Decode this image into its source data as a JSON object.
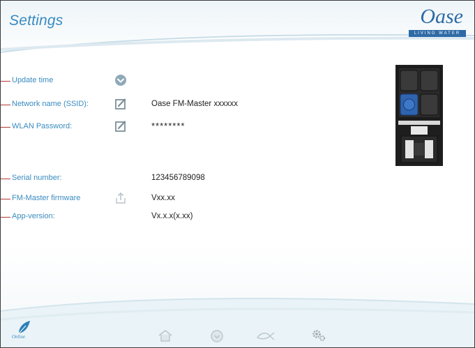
{
  "header": {
    "title": "Settings",
    "logo": {
      "brand": "Oase",
      "tagline": "LIVING WATER"
    }
  },
  "settings": [
    {
      "label": "Update time",
      "icon": "chevron-down-icon",
      "value": ""
    },
    {
      "label": "Network name (SSID):",
      "icon": "edit-icon",
      "value": "Oase FM-Master xxxxxx"
    },
    {
      "label": "WLAN Password:",
      "icon": "edit-icon",
      "value": "********"
    },
    {
      "label": "Serial number:",
      "icon": "",
      "value": "123456789098"
    },
    {
      "label": "FM-Master firmware",
      "icon": "upload-icon",
      "value": "Vxx.xx"
    },
    {
      "label": "App-version:",
      "icon": "",
      "value": "Vx.x.x(x.xx)"
    }
  ],
  "bottom_nav": {
    "status_label": "Online",
    "items": [
      {
        "name": "home",
        "icon": "home-icon"
      },
      {
        "name": "timer",
        "icon": "clock-icon"
      },
      {
        "name": "pond",
        "icon": "fish-icon"
      },
      {
        "name": "settings",
        "icon": "gear-icon"
      }
    ]
  },
  "colors": {
    "accent": "#3a8bc0",
    "label_line": "#b33838",
    "brand": "#2e6aa6",
    "icon_gray": "#8a8a8a"
  }
}
